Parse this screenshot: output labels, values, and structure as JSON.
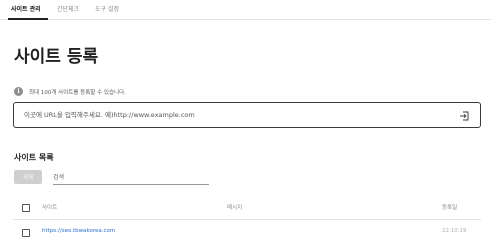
{
  "tabs": [
    {
      "label": "사이트 관리",
      "active": true
    },
    {
      "label": "간단체크",
      "active": false
    },
    {
      "label": "도구 설정",
      "active": false
    }
  ],
  "page_title": "사이트 등록",
  "info": {
    "icon": "info-icon",
    "text": "최대 100개 사이트를 등록할 수 있습니다."
  },
  "url_input": {
    "value": "",
    "placeholder": "이곳에 URL을 입력해주세요. 예)http://www.example.com",
    "submit_icon": "submit-arrow-icon"
  },
  "site_list": {
    "title": "사이트 목록",
    "delete_label": "삭제",
    "search_placeholder": "검색",
    "columns": {
      "site": "사이트",
      "message": "메시지",
      "registered": "등록일"
    },
    "rows": [
      {
        "site": "https://seo.tbwakorea.com",
        "message": "",
        "registered": "22.10.19",
        "checked": false
      }
    ]
  },
  "colors": {
    "link": "#2b6fcf",
    "border": "#3a3a3a",
    "muted": "#888888",
    "button_disabled": "#cfcfcf"
  }
}
